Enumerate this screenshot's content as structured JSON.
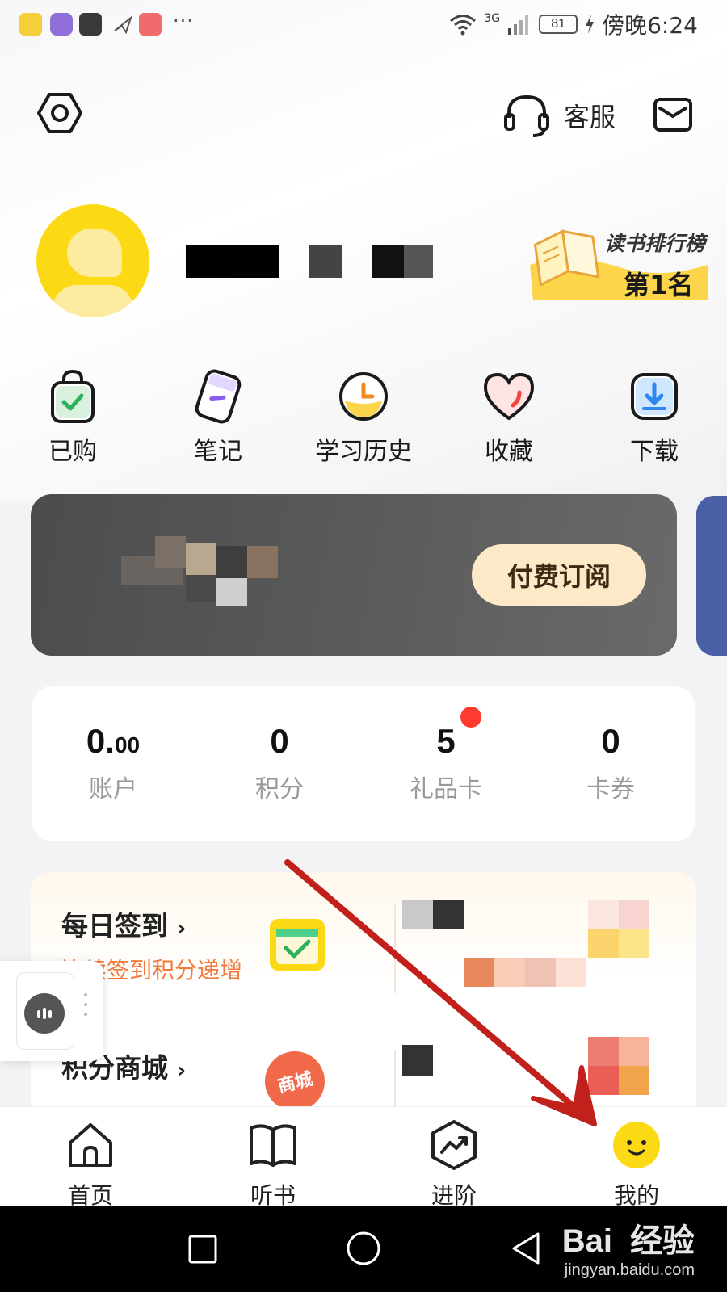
{
  "status_bar": {
    "battery": "81",
    "network": "3G",
    "time": "傍晚6:24",
    "more": "···"
  },
  "header": {
    "settings_icon": "hexagon-gear-icon",
    "service_label": "客服",
    "message_icon": "envelope-icon"
  },
  "profile": {
    "rank_title": "读书排行榜",
    "rank_value": "第1名"
  },
  "shortcuts": [
    {
      "label": "已购",
      "icon": "shopping-bag-icon"
    },
    {
      "label": "笔记",
      "icon": "notebook-icon"
    },
    {
      "label": "学习历史",
      "icon": "clock-icon"
    },
    {
      "label": "收藏",
      "icon": "heart-icon"
    },
    {
      "label": "下载",
      "icon": "download-icon"
    }
  ],
  "subscription": {
    "button_label": "付费订阅"
  },
  "stats": {
    "account": {
      "value_main": "0.",
      "value_small": "00",
      "label": "账户"
    },
    "points": {
      "value": "0",
      "label": "积分"
    },
    "gift_card": {
      "value": "5",
      "label": "礼品卡"
    },
    "coupons": {
      "value": "0",
      "label": "卡券"
    }
  },
  "tasks": {
    "checkin_title": "每日签到",
    "checkin_sub": "连续签到积分递增",
    "mall_title": "积分商城",
    "mall_badge": "商城"
  },
  "bottom_nav": [
    {
      "label": "首页",
      "icon": "home-icon"
    },
    {
      "label": "听书",
      "icon": "open-book-icon"
    },
    {
      "label": "进阶",
      "icon": "trend-up-hexagon-icon"
    },
    {
      "label": "我的",
      "icon": "smiley-icon"
    }
  ],
  "watermark": {
    "brand": "Bai",
    "brand_cn": "经验",
    "url": "jingyan.baidu.com"
  },
  "colors": {
    "accent_yellow": "#fcd915",
    "badge_red": "#ff3b30",
    "subtitle_orange": "#f07a3a",
    "annotation_red": "#c1201b"
  }
}
